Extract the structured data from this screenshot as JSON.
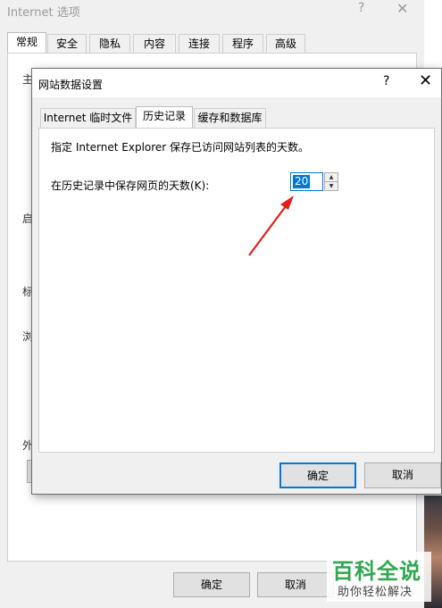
{
  "outer_window": {
    "title": "Internet 选项",
    "help_glyph": "?",
    "close_glyph": "✕",
    "tabs": [
      {
        "label": "常规",
        "active": true
      },
      {
        "label": "安全"
      },
      {
        "label": "隐私"
      },
      {
        "label": "内容"
      },
      {
        "label": "连接"
      },
      {
        "label": "程序"
      },
      {
        "label": "高级"
      }
    ],
    "partial_labels": [
      "主",
      "启",
      "标",
      "浏",
      "外"
    ],
    "ok_label": "确定",
    "cancel_label": "取消"
  },
  "dialog": {
    "title": "网站数据设置",
    "help_glyph": "?",
    "close_glyph": "✕",
    "tabs": [
      {
        "label": "Internet 临时文件"
      },
      {
        "label": "历史记录",
        "active": true
      },
      {
        "label": "缓存和数据库"
      }
    ],
    "description": "指定 Internet Explorer 保存已访问网站列表的天数。",
    "days_label": "在历史记录中保存网页的天数(K):",
    "days_value": "20",
    "ok_label": "确定",
    "cancel_label": "取消"
  },
  "watermark": {
    "main": "百科全说",
    "sub": "助你轻松解决"
  },
  "colors": {
    "accent": "#0078d7",
    "annotation_arrow": "#e0201b",
    "watermark_green": "#2fa84f"
  },
  "icons": [
    "close-icon",
    "help-icon",
    "spin-up-icon",
    "spin-down-icon",
    "red-arrow-annotation"
  ]
}
